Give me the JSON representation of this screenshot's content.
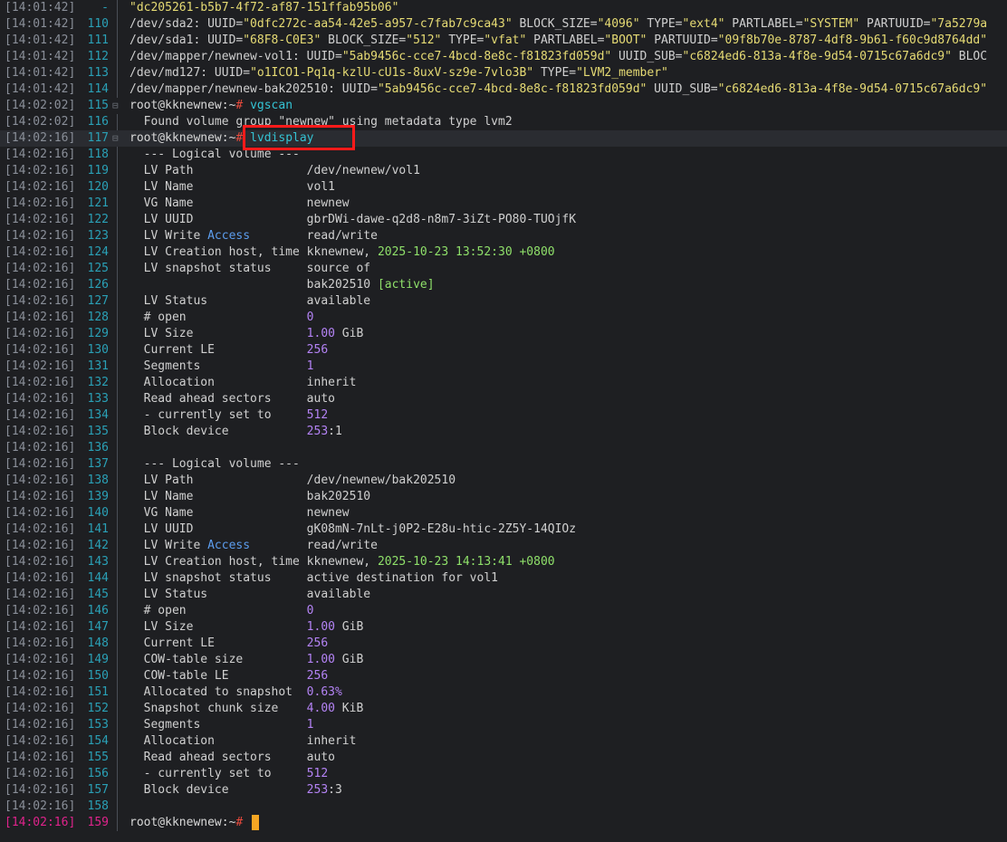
{
  "lines": [
    {
      "ts": "[14:01:42]",
      "ln": "-",
      "fold": "",
      "segs": [
        {
          "t": "\"dc205261-b5b7-4f72-af87-151ffab95b06\"",
          "c": "str"
        }
      ]
    },
    {
      "ts": "[14:01:42]",
      "ln": "110",
      "fold": "",
      "segs": [
        {
          "t": "/dev/sda2: UUID=",
          "c": ""
        },
        {
          "t": "\"0dfc272c-aa54-42e5-a957-c7fab7c9ca43\"",
          "c": "str"
        },
        {
          "t": " BLOCK_SIZE=",
          "c": ""
        },
        {
          "t": "\"4096\"",
          "c": "str"
        },
        {
          "t": " TYPE=",
          "c": ""
        },
        {
          "t": "\"ext4\"",
          "c": "str"
        },
        {
          "t": " PARTLABEL=",
          "c": ""
        },
        {
          "t": "\"SYSTEM\"",
          "c": "str"
        },
        {
          "t": " PARTUUID=",
          "c": ""
        },
        {
          "t": "\"7a5279a",
          "c": "str"
        }
      ]
    },
    {
      "ts": "[14:01:42]",
      "ln": "111",
      "fold": "",
      "segs": [
        {
          "t": "/dev/sda1: UUID=",
          "c": ""
        },
        {
          "t": "\"68F8-C0E3\"",
          "c": "str"
        },
        {
          "t": " BLOCK_SIZE=",
          "c": ""
        },
        {
          "t": "\"512\"",
          "c": "str"
        },
        {
          "t": " TYPE=",
          "c": ""
        },
        {
          "t": "\"vfat\"",
          "c": "str"
        },
        {
          "t": " PARTLABEL=",
          "c": ""
        },
        {
          "t": "\"BOOT\"",
          "c": "str"
        },
        {
          "t": " PARTUUID=",
          "c": ""
        },
        {
          "t": "\"09f8b70e-8787-4df8-9b61-f60c9d8764dd\"",
          "c": "str"
        }
      ]
    },
    {
      "ts": "[14:01:42]",
      "ln": "112",
      "fold": "",
      "segs": [
        {
          "t": "/dev/mapper/newnew-vol1: UUID=",
          "c": ""
        },
        {
          "t": "\"5ab9456c-cce7-4bcd-8e8c-f81823fd059d\"",
          "c": "str"
        },
        {
          "t": " UUID_SUB=",
          "c": ""
        },
        {
          "t": "\"c6824ed6-813a-4f8e-9d54-0715c67a6dc9\"",
          "c": "str"
        },
        {
          "t": " BLOC",
          "c": ""
        }
      ]
    },
    {
      "ts": "[14:01:42]",
      "ln": "113",
      "fold": "",
      "segs": [
        {
          "t": "/dev/md127: UUID=",
          "c": ""
        },
        {
          "t": "\"o1ICO1-Pq1q-kzlU-cU1s-8uxV-sz9e-7vlo3B\"",
          "c": "str"
        },
        {
          "t": " TYPE=",
          "c": ""
        },
        {
          "t": "\"LVM2_member\"",
          "c": "str"
        }
      ]
    },
    {
      "ts": "[14:01:42]",
      "ln": "114",
      "fold": "",
      "segs": [
        {
          "t": "/dev/mapper/newnew-bak202510: UUID=",
          "c": ""
        },
        {
          "t": "\"5ab9456c-cce7-4bcd-8e8c-f81823fd059d\"",
          "c": "str"
        },
        {
          "t": " UUID_SUB=",
          "c": ""
        },
        {
          "t": "\"c6824ed6-813a-4f8e-9d54-0715c67a6dc9\"",
          "c": "str"
        }
      ]
    },
    {
      "ts": "[14:02:02]",
      "ln": "115",
      "fold": "⊟",
      "segs": [
        {
          "t": "root@kknewnew:~",
          "c": "prompt"
        },
        {
          "t": "# ",
          "c": "hash"
        },
        {
          "t": "vgscan",
          "c": "cmd"
        }
      ]
    },
    {
      "ts": "[14:02:02]",
      "ln": "116",
      "fold": "",
      "segs": [
        {
          "t": "  Found volume group \"newnew\" using metadata type lvm2",
          "c": ""
        }
      ]
    },
    {
      "ts": "[14:02:16]",
      "ln": "117",
      "fold": "⊟",
      "current": true,
      "segs": [
        {
          "t": "root@kknewnew:~",
          "c": "prompt"
        },
        {
          "t": "# ",
          "c": "hash"
        },
        {
          "t": "lvdisplay",
          "c": "cmd"
        }
      ]
    },
    {
      "ts": "[14:02:16]",
      "ln": "118",
      "fold": "",
      "segs": [
        {
          "t": "  --- Logical volume ---",
          "c": ""
        }
      ]
    },
    {
      "ts": "[14:02:16]",
      "ln": "119",
      "fold": "",
      "segs": [
        {
          "t": "  LV Path                /dev/newnew/vol1",
          "c": ""
        }
      ]
    },
    {
      "ts": "[14:02:16]",
      "ln": "120",
      "fold": "",
      "segs": [
        {
          "t": "  LV Name                vol1",
          "c": ""
        }
      ]
    },
    {
      "ts": "[14:02:16]",
      "ln": "121",
      "fold": "",
      "segs": [
        {
          "t": "  VG Name                newnew",
          "c": ""
        }
      ]
    },
    {
      "ts": "[14:02:16]",
      "ln": "122",
      "fold": "",
      "segs": [
        {
          "t": "  LV UUID                gbrDWi-dawe-q2d8-n8m7-3iZt-PO80-TUOjfK",
          "c": ""
        }
      ]
    },
    {
      "ts": "[14:02:16]",
      "ln": "123",
      "fold": "",
      "segs": [
        {
          "t": "  LV Write ",
          "c": ""
        },
        {
          "t": "Access",
          "c": "kw"
        },
        {
          "t": "        read/write",
          "c": ""
        }
      ]
    },
    {
      "ts": "[14:02:16]",
      "ln": "124",
      "fold": "",
      "segs": [
        {
          "t": "  LV Creation host, time kknewnew, ",
          "c": ""
        },
        {
          "t": "2025-10-23 13:52:30 +0800",
          "c": "date"
        }
      ]
    },
    {
      "ts": "[14:02:16]",
      "ln": "125",
      "fold": "",
      "segs": [
        {
          "t": "  LV snapshot status     source of",
          "c": ""
        }
      ]
    },
    {
      "ts": "[14:02:16]",
      "ln": "126",
      "fold": "",
      "segs": [
        {
          "t": "                         bak202510 ",
          "c": ""
        },
        {
          "t": "[active]",
          "c": "date"
        }
      ]
    },
    {
      "ts": "[14:02:16]",
      "ln": "127",
      "fold": "",
      "segs": [
        {
          "t": "  LV Status              available",
          "c": ""
        }
      ]
    },
    {
      "ts": "[14:02:16]",
      "ln": "128",
      "fold": "",
      "segs": [
        {
          "t": "  # open                 ",
          "c": ""
        },
        {
          "t": "0",
          "c": "num"
        }
      ]
    },
    {
      "ts": "[14:02:16]",
      "ln": "129",
      "fold": "",
      "segs": [
        {
          "t": "  LV Size                ",
          "c": ""
        },
        {
          "t": "1.00",
          "c": "num"
        },
        {
          "t": " GiB",
          "c": ""
        }
      ]
    },
    {
      "ts": "[14:02:16]",
      "ln": "130",
      "fold": "",
      "segs": [
        {
          "t": "  Current LE             ",
          "c": ""
        },
        {
          "t": "256",
          "c": "num"
        }
      ]
    },
    {
      "ts": "[14:02:16]",
      "ln": "131",
      "fold": "",
      "segs": [
        {
          "t": "  Segments               ",
          "c": ""
        },
        {
          "t": "1",
          "c": "num"
        }
      ]
    },
    {
      "ts": "[14:02:16]",
      "ln": "132",
      "fold": "",
      "segs": [
        {
          "t": "  Allocation             inherit",
          "c": ""
        }
      ]
    },
    {
      "ts": "[14:02:16]",
      "ln": "133",
      "fold": "",
      "segs": [
        {
          "t": "  Read ahead sectors     auto",
          "c": ""
        }
      ]
    },
    {
      "ts": "[14:02:16]",
      "ln": "134",
      "fold": "",
      "segs": [
        {
          "t": "  - currently set to     ",
          "c": ""
        },
        {
          "t": "512",
          "c": "num"
        }
      ]
    },
    {
      "ts": "[14:02:16]",
      "ln": "135",
      "fold": "",
      "segs": [
        {
          "t": "  Block device           ",
          "c": ""
        },
        {
          "t": "253",
          "c": "num"
        },
        {
          "t": ":1",
          "c": ""
        }
      ]
    },
    {
      "ts": "[14:02:16]",
      "ln": "136",
      "fold": "",
      "segs": [
        {
          "t": "",
          "c": ""
        }
      ]
    },
    {
      "ts": "[14:02:16]",
      "ln": "137",
      "fold": "",
      "segs": [
        {
          "t": "  --- Logical volume ---",
          "c": ""
        }
      ]
    },
    {
      "ts": "[14:02:16]",
      "ln": "138",
      "fold": "",
      "segs": [
        {
          "t": "  LV Path                /dev/newnew/bak202510",
          "c": ""
        }
      ]
    },
    {
      "ts": "[14:02:16]",
      "ln": "139",
      "fold": "",
      "segs": [
        {
          "t": "  LV Name                bak202510",
          "c": ""
        }
      ]
    },
    {
      "ts": "[14:02:16]",
      "ln": "140",
      "fold": "",
      "segs": [
        {
          "t": "  VG Name                newnew",
          "c": ""
        }
      ]
    },
    {
      "ts": "[14:02:16]",
      "ln": "141",
      "fold": "",
      "segs": [
        {
          "t": "  LV UUID                gK08mN-7nLt-j0P2-E28u-htic-2Z5Y-14QIOz",
          "c": ""
        }
      ]
    },
    {
      "ts": "[14:02:16]",
      "ln": "142",
      "fold": "",
      "segs": [
        {
          "t": "  LV Write ",
          "c": ""
        },
        {
          "t": "Access",
          "c": "kw"
        },
        {
          "t": "        read/write",
          "c": ""
        }
      ]
    },
    {
      "ts": "[14:02:16]",
      "ln": "143",
      "fold": "",
      "segs": [
        {
          "t": "  LV Creation host, time kknewnew, ",
          "c": ""
        },
        {
          "t": "2025-10-23 14:13:41 +0800",
          "c": "date"
        }
      ]
    },
    {
      "ts": "[14:02:16]",
      "ln": "144",
      "fold": "",
      "segs": [
        {
          "t": "  LV snapshot status     active destination for vol1",
          "c": ""
        }
      ]
    },
    {
      "ts": "[14:02:16]",
      "ln": "145",
      "fold": "",
      "segs": [
        {
          "t": "  LV Status              available",
          "c": ""
        }
      ]
    },
    {
      "ts": "[14:02:16]",
      "ln": "146",
      "fold": "",
      "segs": [
        {
          "t": "  # open                 ",
          "c": ""
        },
        {
          "t": "0",
          "c": "num"
        }
      ]
    },
    {
      "ts": "[14:02:16]",
      "ln": "147",
      "fold": "",
      "segs": [
        {
          "t": "  LV Size                ",
          "c": ""
        },
        {
          "t": "1.00",
          "c": "num"
        },
        {
          "t": " GiB",
          "c": ""
        }
      ]
    },
    {
      "ts": "[14:02:16]",
      "ln": "148",
      "fold": "",
      "segs": [
        {
          "t": "  Current LE             ",
          "c": ""
        },
        {
          "t": "256",
          "c": "num"
        }
      ]
    },
    {
      "ts": "[14:02:16]",
      "ln": "149",
      "fold": "",
      "segs": [
        {
          "t": "  COW-table size         ",
          "c": ""
        },
        {
          "t": "1.00",
          "c": "num"
        },
        {
          "t": " GiB",
          "c": ""
        }
      ]
    },
    {
      "ts": "[14:02:16]",
      "ln": "150",
      "fold": "",
      "segs": [
        {
          "t": "  COW-table LE           ",
          "c": ""
        },
        {
          "t": "256",
          "c": "num"
        }
      ]
    },
    {
      "ts": "[14:02:16]",
      "ln": "151",
      "fold": "",
      "segs": [
        {
          "t": "  Allocated to snapshot  ",
          "c": ""
        },
        {
          "t": "0.63%",
          "c": "num"
        }
      ]
    },
    {
      "ts": "[14:02:16]",
      "ln": "152",
      "fold": "",
      "segs": [
        {
          "t": "  Snapshot chunk size    ",
          "c": ""
        },
        {
          "t": "4.00",
          "c": "num"
        },
        {
          "t": " KiB",
          "c": ""
        }
      ]
    },
    {
      "ts": "[14:02:16]",
      "ln": "153",
      "fold": "",
      "segs": [
        {
          "t": "  Segments               ",
          "c": ""
        },
        {
          "t": "1",
          "c": "num"
        }
      ]
    },
    {
      "ts": "[14:02:16]",
      "ln": "154",
      "fold": "",
      "segs": [
        {
          "t": "  Allocation             inherit",
          "c": ""
        }
      ]
    },
    {
      "ts": "[14:02:16]",
      "ln": "155",
      "fold": "",
      "segs": [
        {
          "t": "  Read ahead sectors     auto",
          "c": ""
        }
      ]
    },
    {
      "ts": "[14:02:16]",
      "ln": "156",
      "fold": "",
      "segs": [
        {
          "t": "  - currently set to     ",
          "c": ""
        },
        {
          "t": "512",
          "c": "num"
        }
      ]
    },
    {
      "ts": "[14:02:16]",
      "ln": "157",
      "fold": "",
      "segs": [
        {
          "t": "  Block device           ",
          "c": ""
        },
        {
          "t": "253",
          "c": "num"
        },
        {
          "t": ":3",
          "c": ""
        }
      ]
    },
    {
      "ts": "[14:02:16]",
      "ln": "158",
      "fold": "",
      "segs": [
        {
          "t": "",
          "c": ""
        }
      ]
    },
    {
      "ts": "[14:02:16]",
      "ln": "159",
      "fold": "",
      "last": true,
      "cursor": true,
      "segs": [
        {
          "t": "root@kknewnew:~",
          "c": "prompt"
        },
        {
          "t": "# ",
          "c": "hash"
        }
      ]
    }
  ],
  "colors": {
    "background": "#1e1f22",
    "timestamp": "#8a8f99",
    "line_number": "#2aa0b6",
    "string": "#e6db74",
    "number": "#b483f5",
    "date": "#8fe06a",
    "keyword": "#5c9ded",
    "command": "#34c3d4",
    "prompt_hash": "#e84a3c",
    "highlight_box": "#ff1a1a",
    "cursor": "#f5a623"
  },
  "icons": {
    "fold": "fold-toggle-icon",
    "cursor": "text-cursor"
  }
}
